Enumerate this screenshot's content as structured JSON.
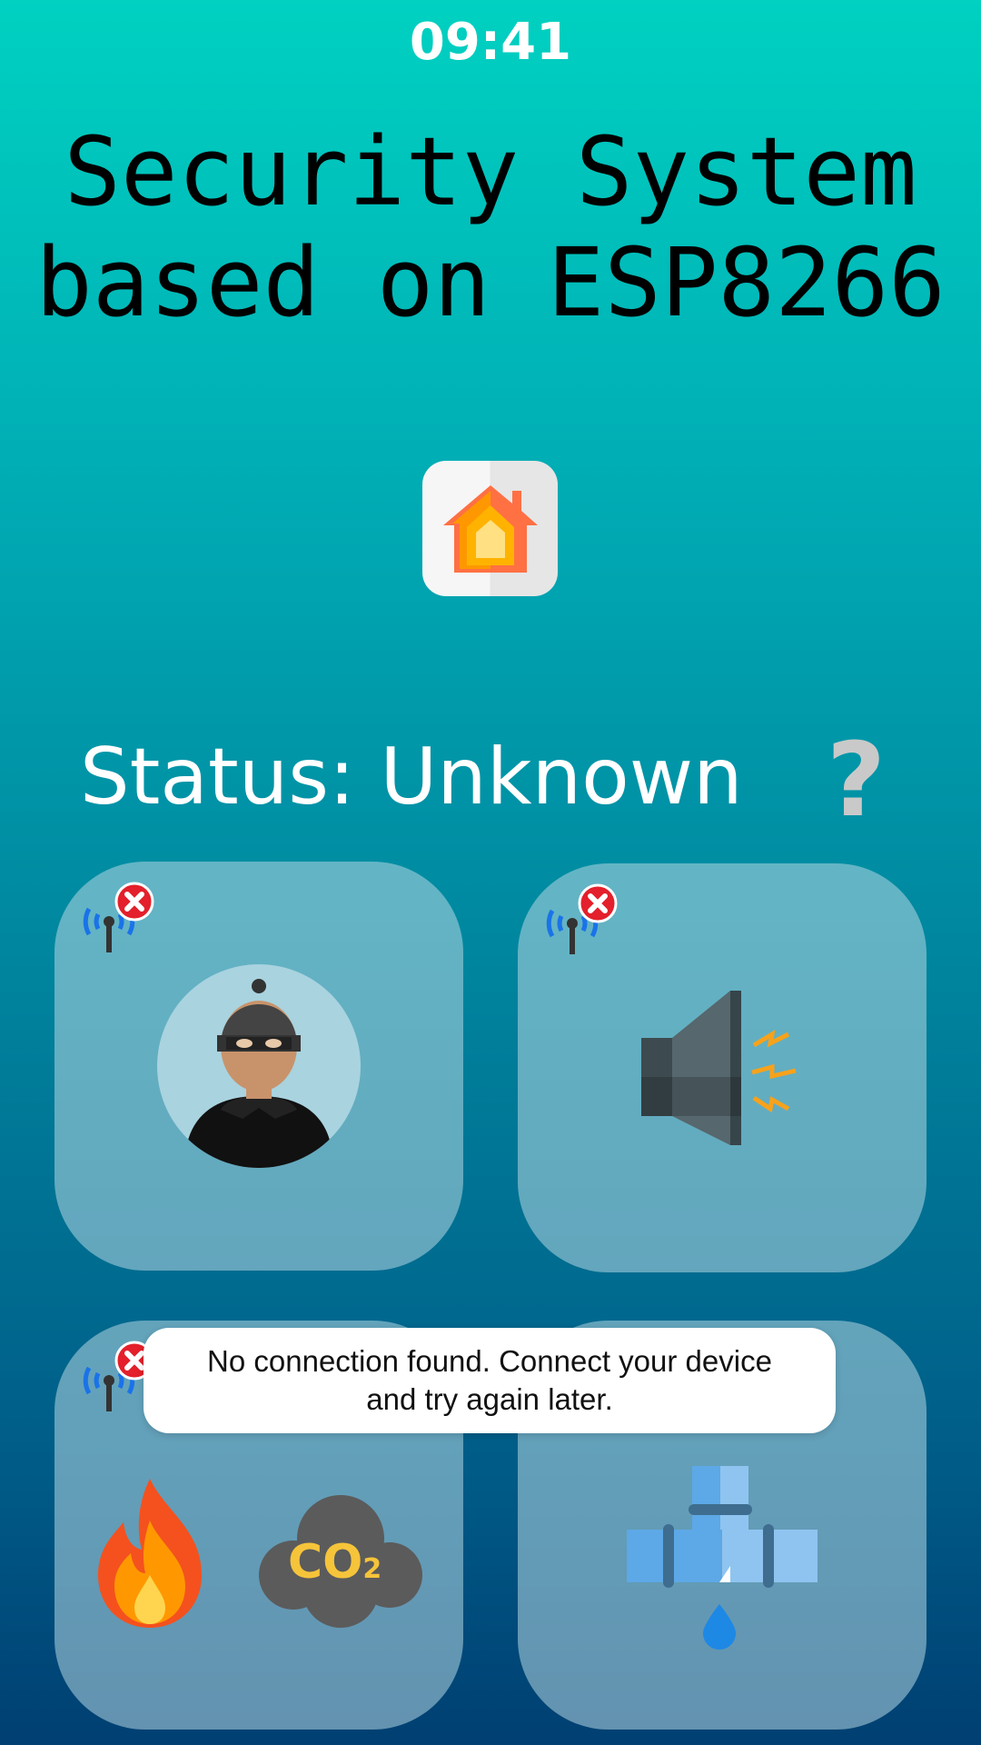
{
  "status_bar": {
    "time": "09:41"
  },
  "header": {
    "title_line1": "Security System",
    "title_line2": "based on ESP8266"
  },
  "logo": {
    "icon": "home-icon"
  },
  "status": {
    "label": "Status: Unknown",
    "indicator": "?"
  },
  "cards": [
    {
      "name": "intruder-sensor",
      "icon": "burglar-icon",
      "connection": "disconnected"
    },
    {
      "name": "siren",
      "icon": "speaker-icon",
      "connection": "disconnected"
    },
    {
      "name": "fire-gas-sensor",
      "icons": [
        "fire-icon",
        "co2-icon"
      ],
      "co2_text": "CO",
      "co2_sub": "2",
      "connection": "disconnected"
    },
    {
      "name": "water-leak-sensor",
      "icon": "pipe-leak-icon",
      "connection": "disconnected"
    }
  ],
  "toast": {
    "message": "No connection found. Connect your device and try again later."
  },
  "colors": {
    "bg_top": "#00d1c1",
    "bg_bottom": "#003f72",
    "error_red": "#e3202b",
    "antenna_blue": "#1a73e8"
  }
}
